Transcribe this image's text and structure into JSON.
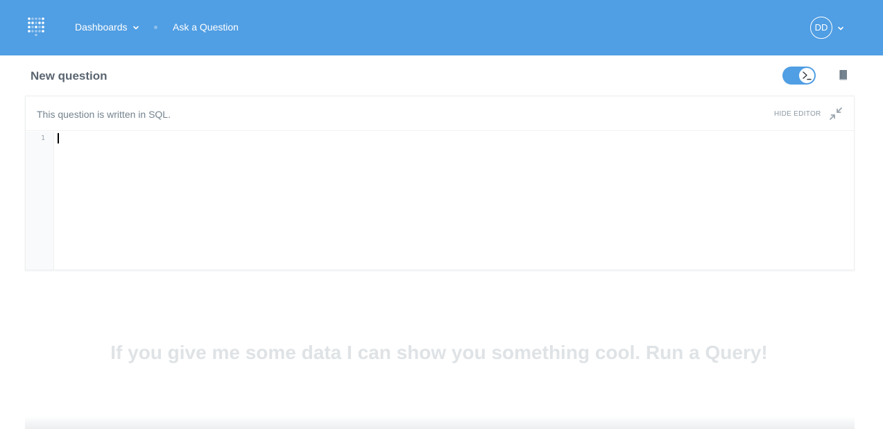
{
  "nav": {
    "logo_icon": "metabase-logo-icon",
    "dashboards_label": "Dashboards",
    "ask_question_label": "Ask a Question",
    "user_initials": "DD",
    "accent_color": "#509ee3"
  },
  "question": {
    "title": "New question",
    "mode_toggle_icon": "terminal-icon",
    "reference_icon": "book-icon"
  },
  "editor": {
    "note": "This question is written in SQL.",
    "hide_editor_label": "HIDE EDITOR",
    "contract_icon": "contract-icon",
    "line_numbers": [
      "1"
    ],
    "query_text": ""
  },
  "empty_state": {
    "message": "If you give me some data I can show you something cool. Run a Query!"
  }
}
